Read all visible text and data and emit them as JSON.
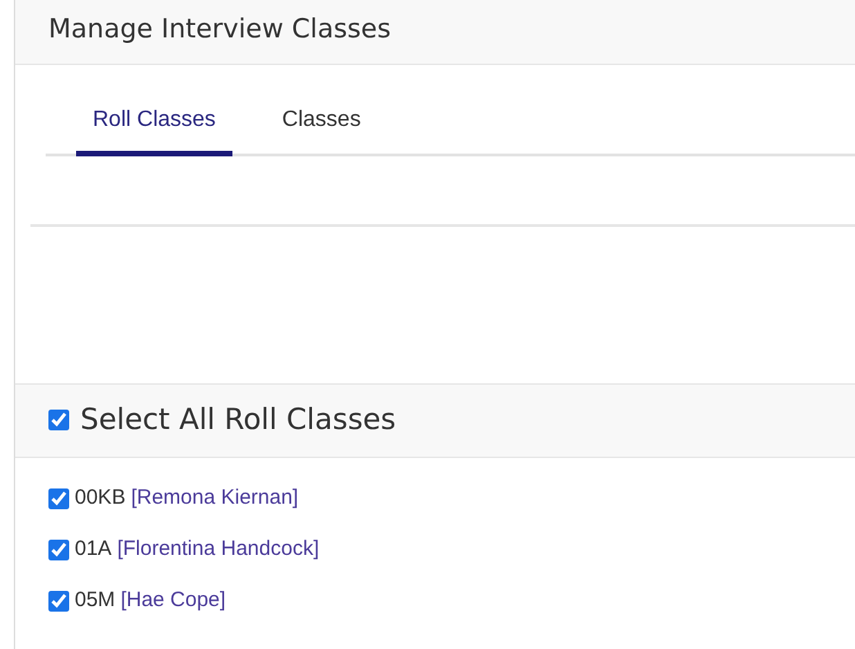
{
  "title": "Manage Interview Classes",
  "tabs": [
    {
      "label": "Roll Classes",
      "selected": true
    },
    {
      "label": "Classes",
      "selected": false
    }
  ],
  "select_all": {
    "label": "Select All Roll Classes",
    "checked": true
  },
  "roll_classes": [
    {
      "code": "00KB",
      "teacher": "[Remona Kiernan]",
      "checked": true
    },
    {
      "code": "01A",
      "teacher": "[Florentina Handcock]",
      "checked": true
    },
    {
      "code": "05M",
      "teacher": "[Hae Cope]",
      "checked": true
    }
  ]
}
